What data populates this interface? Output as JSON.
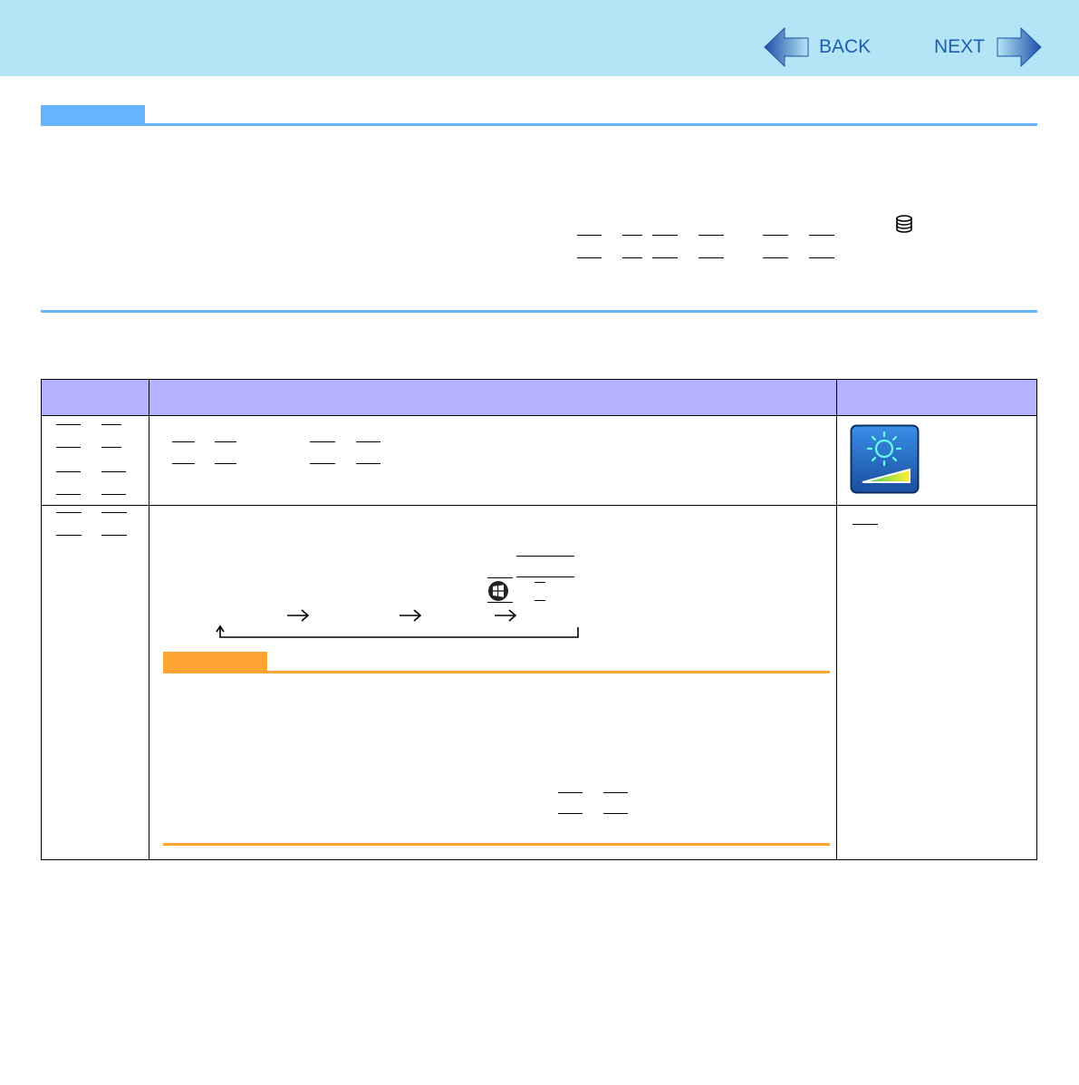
{
  "nav": {
    "back_label": "BACK",
    "next_label": "NEXT"
  },
  "icons": {
    "back": "back-arrow-icon",
    "next": "next-arrow-icon",
    "disk": "database-icon",
    "brightness": "brightness-icon",
    "windows": "windows-logo-icon"
  },
  "colors": {
    "header_bg": "#b3e5f7",
    "nav_text": "#1f5fae",
    "section_tab": "#66b3ff",
    "section_line": "#66b3ff",
    "table_header_bg": "#b3b3ff",
    "caution_tab": "#ffa533",
    "caution_line": "#ffa533",
    "brightness_icon_bg": "#2277cc"
  }
}
